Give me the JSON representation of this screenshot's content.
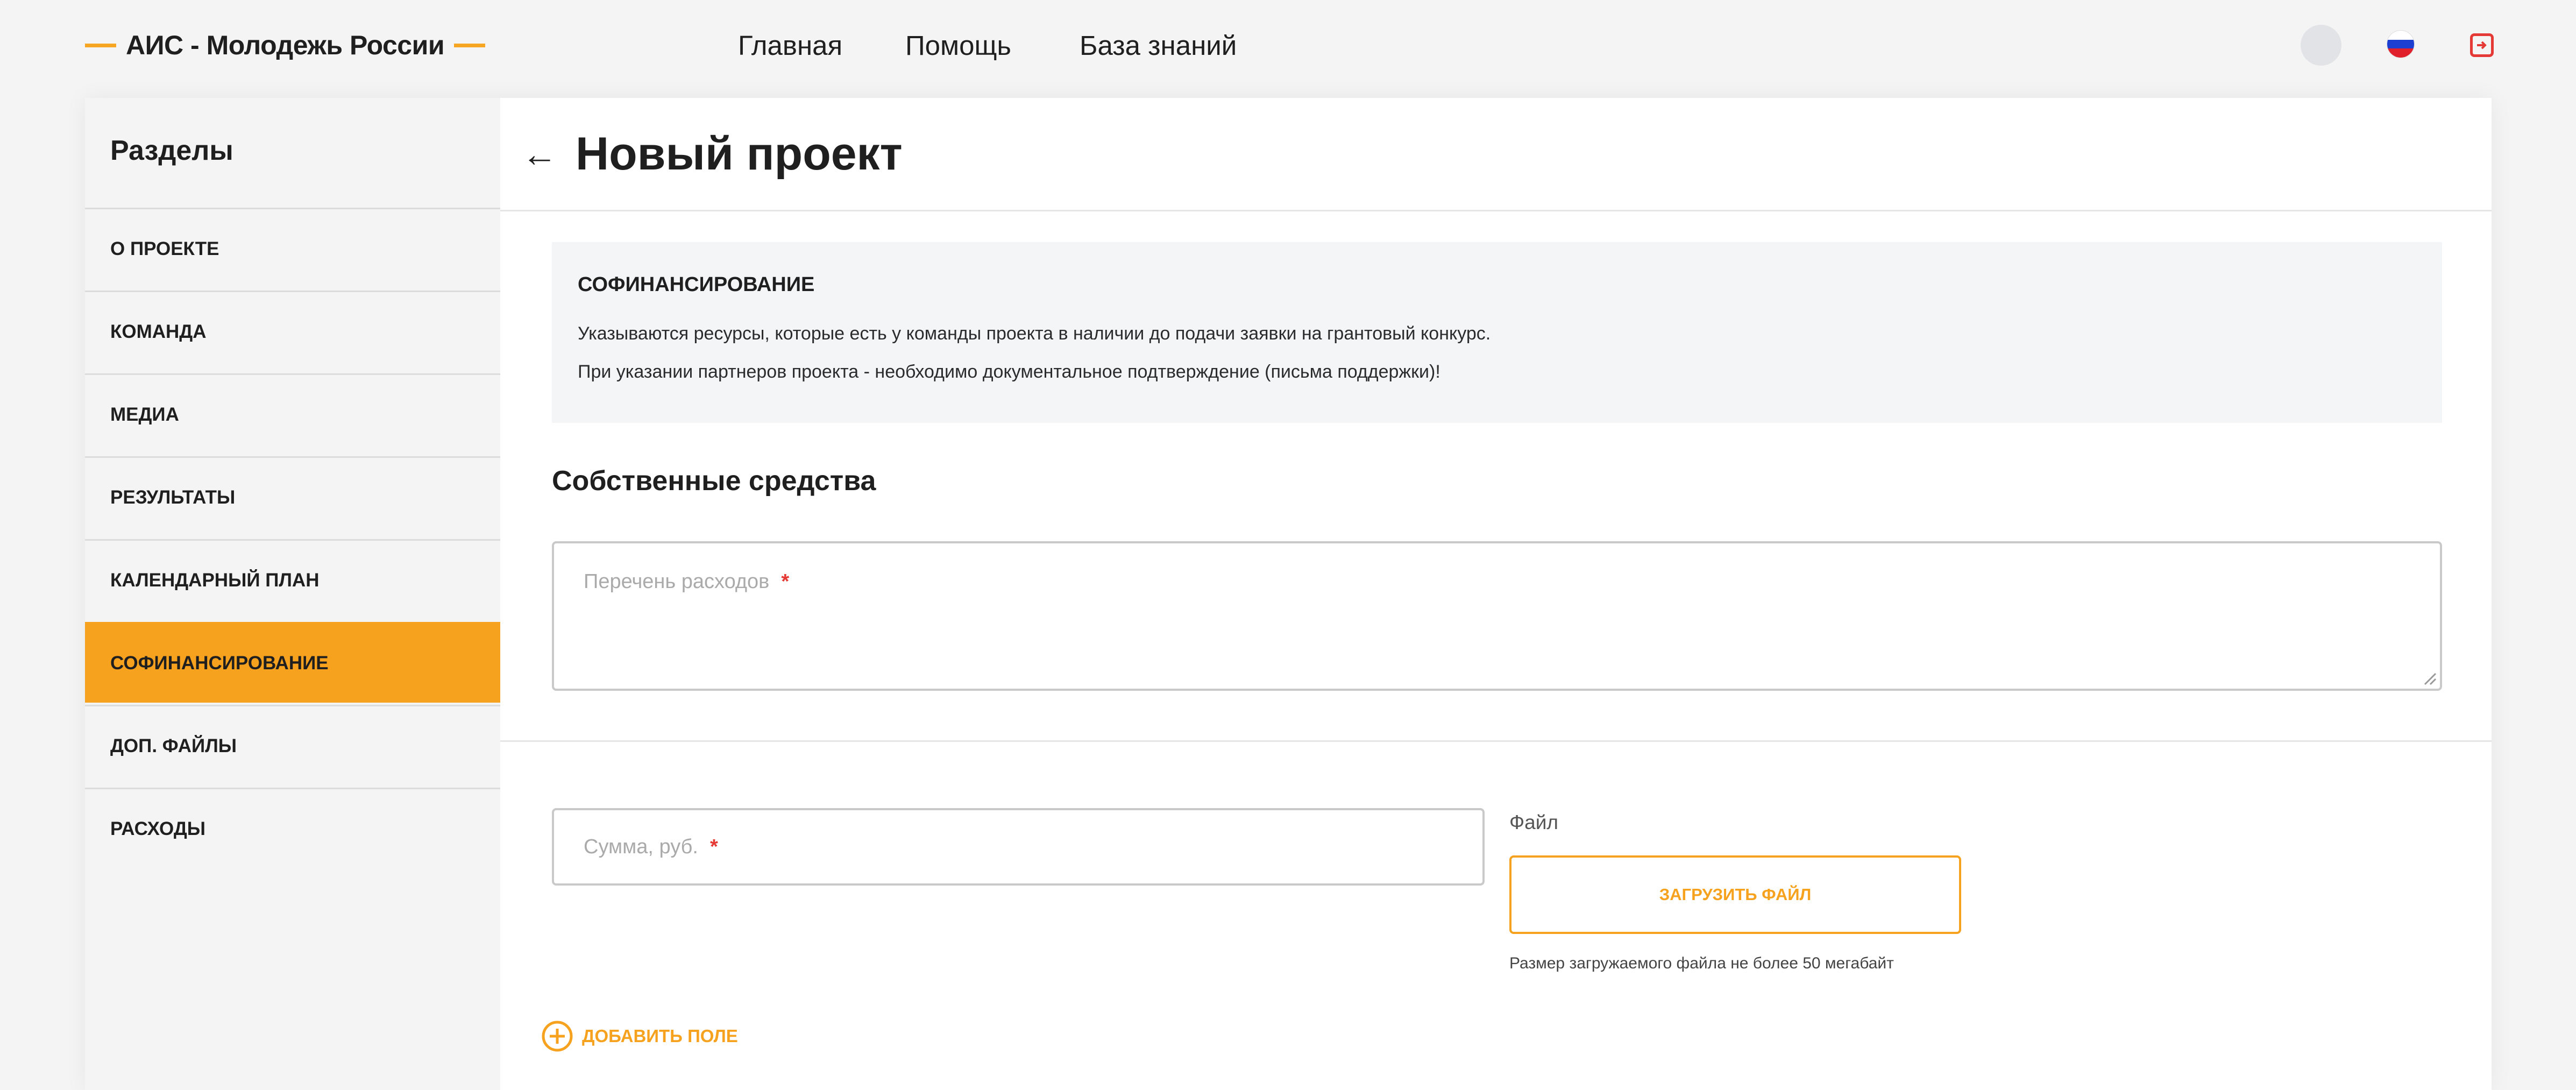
{
  "header": {
    "logo_text": "АИС - Молодежь России",
    "nav": [
      "Главная",
      "Помощь",
      "База знаний"
    ],
    "icons": [
      "avatar",
      "russia-flag-icon",
      "logout-icon"
    ]
  },
  "sidebar": {
    "title": "Разделы",
    "items": [
      {
        "label": "О проекте",
        "active": false
      },
      {
        "label": "Команда",
        "active": false
      },
      {
        "label": "Медиа",
        "active": false
      },
      {
        "label": "Результаты",
        "active": false
      },
      {
        "label": "Календарный план",
        "active": false
      },
      {
        "label": "Софинансирование",
        "active": true
      },
      {
        "label": "Доп. файлы",
        "active": false
      },
      {
        "label": "Расходы",
        "active": false
      }
    ]
  },
  "main": {
    "back_arrow": "←",
    "title": "Новый проект",
    "info": {
      "title": "СОФИНАНСИРОВАНИЕ",
      "line1": "Указываются ресурсы, которые есть у команды проекта в наличии до подачи заявки на грантовый конкурс.",
      "line2": "При указании партнеров проекта - необходимо документальное подтверждение (письма поддержки)!"
    },
    "section_title": "Собственные средства",
    "expenses_placeholder": "Перечень расходов",
    "sum_placeholder": "Сумма, руб.",
    "required_mark": "*",
    "file_label": "Файл",
    "upload_button": "Загрузить файл",
    "file_hint": "Размер загружаемого файла не более 50 мегабайт",
    "add_field": "Добавить поле"
  },
  "colors": {
    "accent": "#f6a21e",
    "required": "#e53935",
    "page_bg": "#f4f4f4"
  }
}
